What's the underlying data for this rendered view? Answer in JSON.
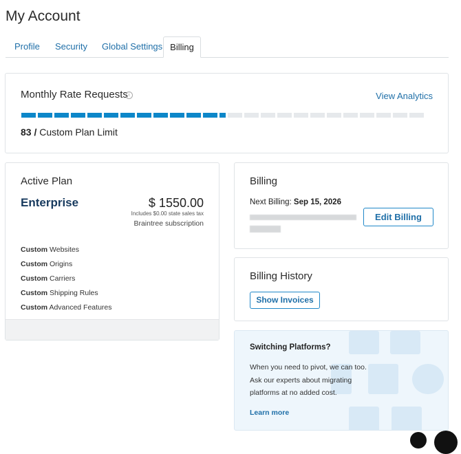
{
  "page": {
    "title": "My Account"
  },
  "tabs": [
    {
      "label": "Profile",
      "active": false
    },
    {
      "label": "Security",
      "active": false
    },
    {
      "label": "Global Settings",
      "active": false
    },
    {
      "label": "Billing",
      "active": true
    }
  ],
  "rate_requests": {
    "title": "Monthly Rate Requests",
    "info_icon": "info-icon",
    "analytics_link": "View Analytics",
    "used": "83",
    "separator": "/",
    "limit_label": "Custom Plan Limit",
    "progress_filled_segments": 13,
    "progress_total_segments": 25,
    "progress_color": "#0d87c9"
  },
  "active_plan": {
    "heading": "Active Plan",
    "plan_name": "Enterprise",
    "price": "$ 1550.00",
    "tax_note": "Includes $0.00 state sales tax",
    "subscription": "Braintree subscription",
    "features": [
      {
        "bold": "Custom",
        "text": "Websites"
      },
      {
        "bold": "Custom",
        "text": "Origins"
      },
      {
        "bold": "Custom",
        "text": "Carriers"
      },
      {
        "bold": "Custom",
        "text": "Shipping Rules"
      },
      {
        "bold": "Custom",
        "text": "Advanced Features"
      }
    ]
  },
  "billing": {
    "heading": "Billing",
    "next_label": "Next Billing:",
    "next_date": "Sep 15, 2026",
    "edit_button": "Edit Billing"
  },
  "billing_history": {
    "heading": "Billing History",
    "button": "Show Invoices"
  },
  "switching": {
    "heading": "Switching Platforms?",
    "line1": "When you need to pivot, we can too.",
    "line2": "Ask our experts about migrating",
    "line3": "platforms at no added cost.",
    "link": "Learn more",
    "logos": [
      "magento-logo",
      "adobe-logo",
      "bigcommerce-logo",
      "salesforce-logo",
      "zen-logo",
      "woo-logo"
    ]
  },
  "colors": {
    "link": "#1f6fa8",
    "accent": "#0d87c9",
    "brand_dark": "#173a5e"
  }
}
